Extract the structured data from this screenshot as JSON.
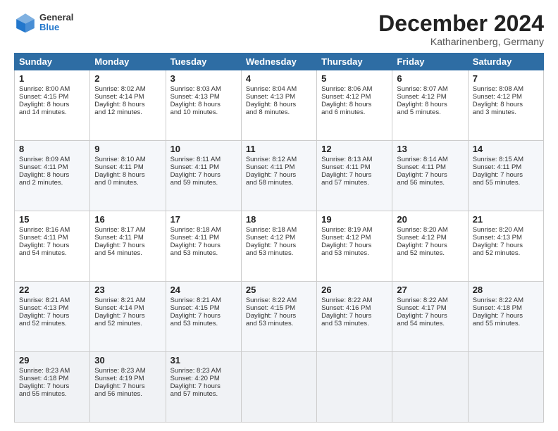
{
  "header": {
    "logo_line1": "General",
    "logo_line2": "Blue",
    "title": "December 2024",
    "location": "Katharinenberg, Germany"
  },
  "days_of_week": [
    "Sunday",
    "Monday",
    "Tuesday",
    "Wednesday",
    "Thursday",
    "Friday",
    "Saturday"
  ],
  "weeks": [
    [
      {
        "day": "1",
        "lines": [
          "Sunrise: 8:00 AM",
          "Sunset: 4:15 PM",
          "Daylight: 8 hours",
          "and 14 minutes."
        ]
      },
      {
        "day": "2",
        "lines": [
          "Sunrise: 8:02 AM",
          "Sunset: 4:14 PM",
          "Daylight: 8 hours",
          "and 12 minutes."
        ]
      },
      {
        "day": "3",
        "lines": [
          "Sunrise: 8:03 AM",
          "Sunset: 4:13 PM",
          "Daylight: 8 hours",
          "and 10 minutes."
        ]
      },
      {
        "day": "4",
        "lines": [
          "Sunrise: 8:04 AM",
          "Sunset: 4:13 PM",
          "Daylight: 8 hours",
          "and 8 minutes."
        ]
      },
      {
        "day": "5",
        "lines": [
          "Sunrise: 8:06 AM",
          "Sunset: 4:12 PM",
          "Daylight: 8 hours",
          "and 6 minutes."
        ]
      },
      {
        "day": "6",
        "lines": [
          "Sunrise: 8:07 AM",
          "Sunset: 4:12 PM",
          "Daylight: 8 hours",
          "and 5 minutes."
        ]
      },
      {
        "day": "7",
        "lines": [
          "Sunrise: 8:08 AM",
          "Sunset: 4:12 PM",
          "Daylight: 8 hours",
          "and 3 minutes."
        ]
      }
    ],
    [
      {
        "day": "8",
        "lines": [
          "Sunrise: 8:09 AM",
          "Sunset: 4:11 PM",
          "Daylight: 8 hours",
          "and 2 minutes."
        ]
      },
      {
        "day": "9",
        "lines": [
          "Sunrise: 8:10 AM",
          "Sunset: 4:11 PM",
          "Daylight: 8 hours",
          "and 0 minutes."
        ]
      },
      {
        "day": "10",
        "lines": [
          "Sunrise: 8:11 AM",
          "Sunset: 4:11 PM",
          "Daylight: 7 hours",
          "and 59 minutes."
        ]
      },
      {
        "day": "11",
        "lines": [
          "Sunrise: 8:12 AM",
          "Sunset: 4:11 PM",
          "Daylight: 7 hours",
          "and 58 minutes."
        ]
      },
      {
        "day": "12",
        "lines": [
          "Sunrise: 8:13 AM",
          "Sunset: 4:11 PM",
          "Daylight: 7 hours",
          "and 57 minutes."
        ]
      },
      {
        "day": "13",
        "lines": [
          "Sunrise: 8:14 AM",
          "Sunset: 4:11 PM",
          "Daylight: 7 hours",
          "and 56 minutes."
        ]
      },
      {
        "day": "14",
        "lines": [
          "Sunrise: 8:15 AM",
          "Sunset: 4:11 PM",
          "Daylight: 7 hours",
          "and 55 minutes."
        ]
      }
    ],
    [
      {
        "day": "15",
        "lines": [
          "Sunrise: 8:16 AM",
          "Sunset: 4:11 PM",
          "Daylight: 7 hours",
          "and 54 minutes."
        ]
      },
      {
        "day": "16",
        "lines": [
          "Sunrise: 8:17 AM",
          "Sunset: 4:11 PM",
          "Daylight: 7 hours",
          "and 54 minutes."
        ]
      },
      {
        "day": "17",
        "lines": [
          "Sunrise: 8:18 AM",
          "Sunset: 4:11 PM",
          "Daylight: 7 hours",
          "and 53 minutes."
        ]
      },
      {
        "day": "18",
        "lines": [
          "Sunrise: 8:18 AM",
          "Sunset: 4:12 PM",
          "Daylight: 7 hours",
          "and 53 minutes."
        ]
      },
      {
        "day": "19",
        "lines": [
          "Sunrise: 8:19 AM",
          "Sunset: 4:12 PM",
          "Daylight: 7 hours",
          "and 53 minutes."
        ]
      },
      {
        "day": "20",
        "lines": [
          "Sunrise: 8:20 AM",
          "Sunset: 4:12 PM",
          "Daylight: 7 hours",
          "and 52 minutes."
        ]
      },
      {
        "day": "21",
        "lines": [
          "Sunrise: 8:20 AM",
          "Sunset: 4:13 PM",
          "Daylight: 7 hours",
          "and 52 minutes."
        ]
      }
    ],
    [
      {
        "day": "22",
        "lines": [
          "Sunrise: 8:21 AM",
          "Sunset: 4:13 PM",
          "Daylight: 7 hours",
          "and 52 minutes."
        ]
      },
      {
        "day": "23",
        "lines": [
          "Sunrise: 8:21 AM",
          "Sunset: 4:14 PM",
          "Daylight: 7 hours",
          "and 52 minutes."
        ]
      },
      {
        "day": "24",
        "lines": [
          "Sunrise: 8:21 AM",
          "Sunset: 4:15 PM",
          "Daylight: 7 hours",
          "and 53 minutes."
        ]
      },
      {
        "day": "25",
        "lines": [
          "Sunrise: 8:22 AM",
          "Sunset: 4:15 PM",
          "Daylight: 7 hours",
          "and 53 minutes."
        ]
      },
      {
        "day": "26",
        "lines": [
          "Sunrise: 8:22 AM",
          "Sunset: 4:16 PM",
          "Daylight: 7 hours",
          "and 53 minutes."
        ]
      },
      {
        "day": "27",
        "lines": [
          "Sunrise: 8:22 AM",
          "Sunset: 4:17 PM",
          "Daylight: 7 hours",
          "and 54 minutes."
        ]
      },
      {
        "day": "28",
        "lines": [
          "Sunrise: 8:22 AM",
          "Sunset: 4:18 PM",
          "Daylight: 7 hours",
          "and 55 minutes."
        ]
      }
    ],
    [
      {
        "day": "29",
        "lines": [
          "Sunrise: 8:23 AM",
          "Sunset: 4:18 PM",
          "Daylight: 7 hours",
          "and 55 minutes."
        ]
      },
      {
        "day": "30",
        "lines": [
          "Sunrise: 8:23 AM",
          "Sunset: 4:19 PM",
          "Daylight: 7 hours",
          "and 56 minutes."
        ]
      },
      {
        "day": "31",
        "lines": [
          "Sunrise: 8:23 AM",
          "Sunset: 4:20 PM",
          "Daylight: 7 hours",
          "and 57 minutes."
        ]
      },
      null,
      null,
      null,
      null
    ]
  ]
}
